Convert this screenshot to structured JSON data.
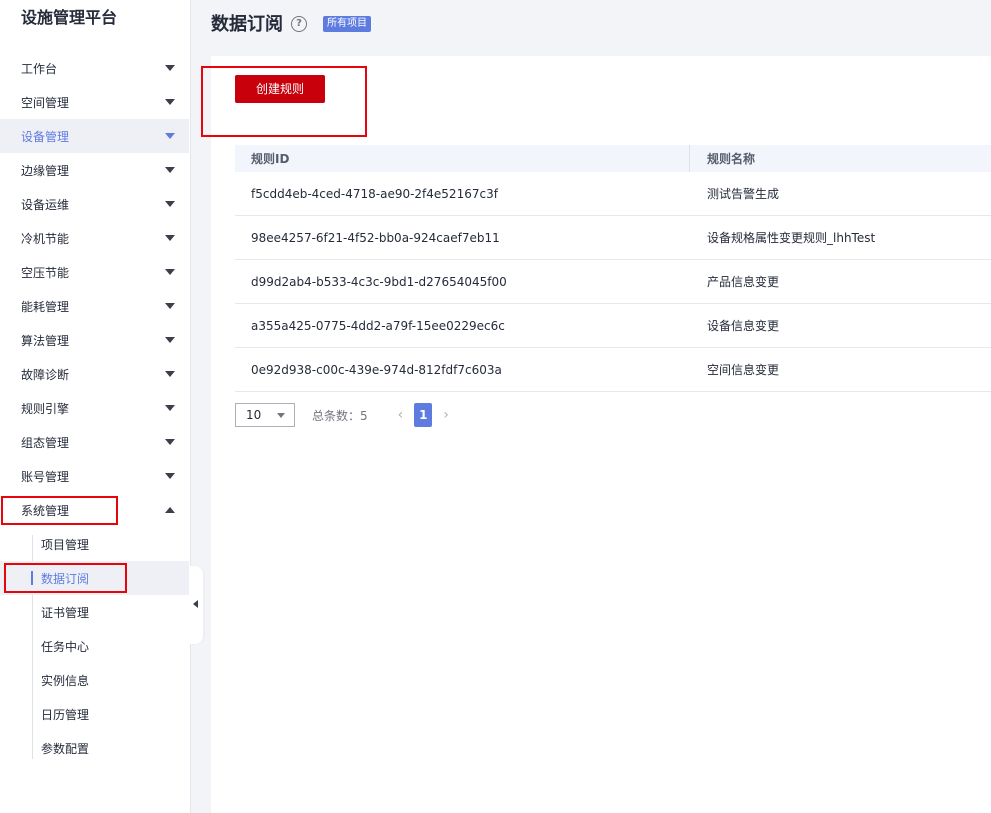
{
  "app": {
    "title": "设施管理平台"
  },
  "sidebar": {
    "items": [
      {
        "label": "工作台"
      },
      {
        "label": "空间管理"
      },
      {
        "label": "设备管理"
      },
      {
        "label": "边缘管理"
      },
      {
        "label": "设备运维"
      },
      {
        "label": "冷机节能"
      },
      {
        "label": "空压节能"
      },
      {
        "label": "能耗管理"
      },
      {
        "label": "算法管理"
      },
      {
        "label": "故障诊断"
      },
      {
        "label": "规则引擎"
      },
      {
        "label": "组态管理"
      },
      {
        "label": "账号管理"
      },
      {
        "label": "系统管理"
      }
    ],
    "subitems": [
      {
        "label": "项目管理"
      },
      {
        "label": "数据订阅"
      },
      {
        "label": "证书管理"
      },
      {
        "label": "任务中心"
      },
      {
        "label": "实例信息"
      },
      {
        "label": "日历管理"
      },
      {
        "label": "参数配置"
      }
    ]
  },
  "header": {
    "title": "数据订阅",
    "help_icon": "?",
    "badge": "所有项目"
  },
  "toolbar": {
    "create_label": "创建规则"
  },
  "table": {
    "headers": [
      "规则ID",
      "规则名称"
    ],
    "rows": [
      [
        "f5cdd4eb-4ced-4718-ae90-2f4e52167c3f",
        "测试告警生成"
      ],
      [
        "98ee4257-6f21-4f52-bb0a-924caef7eb11",
        "设备规格属性变更规则_lhhTest"
      ],
      [
        "d99d2ab4-b533-4c3c-9bd1-d27654045f00",
        "产品信息变更"
      ],
      [
        "a355a425-0775-4dd2-a79f-15ee0229ec6c",
        "设备信息变更"
      ],
      [
        "0e92d938-c00c-439e-974d-812fdf7c603a",
        "空间信息变更"
      ]
    ]
  },
  "pagination": {
    "page_size": "10",
    "total_label": "总条数：5",
    "prev": "‹",
    "current": "1",
    "next": "›"
  },
  "colors": {
    "accent": "#5e7ce0",
    "primary_button": "#c7000b",
    "highlight": "#e5050a"
  }
}
